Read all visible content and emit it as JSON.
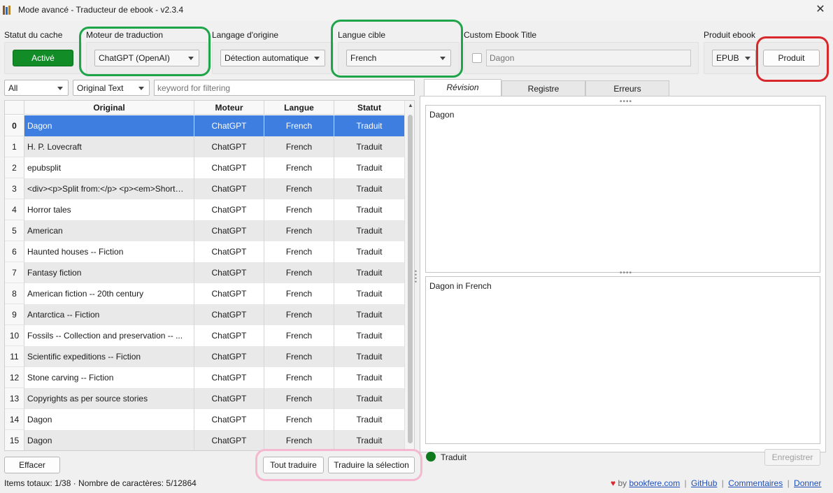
{
  "window": {
    "title": "Mode avancé - Traducteur de ebook - v2.3.4",
    "close_glyph": "✕"
  },
  "cache": {
    "label": "Statut du cache",
    "button": "Activé",
    "color": "#118c26"
  },
  "engine": {
    "label": "Moteur de traduction",
    "value": "ChatGPT (OpenAI)"
  },
  "source_lang": {
    "label": "Langage d'origine",
    "value": "Détection automatique"
  },
  "target_lang": {
    "label": "Langue cible",
    "value": "French"
  },
  "custom_title": {
    "label": "Custom Ebook Title",
    "placeholder": "Dagon"
  },
  "output": {
    "label": "Produit ebook",
    "format": "EPUB",
    "button": "Produit"
  },
  "filter": {
    "scope": "All",
    "mode": "Original Text",
    "placeholder": "keyword for filtering"
  },
  "table": {
    "headers": {
      "original": "Original",
      "engine": "Moteur",
      "language": "Langue",
      "status": "Statut"
    },
    "rows": [
      {
        "idx": "0",
        "original": "Dagon",
        "engine": "ChatGPT",
        "language": "French",
        "status": "Traduit"
      },
      {
        "idx": "1",
        "original": "H. P. Lovecraft",
        "engine": "ChatGPT",
        "language": "French",
        "status": "Traduit"
      },
      {
        "idx": "2",
        "original": "epubsplit",
        "engine": "ChatGPT",
        "language": "French",
        "status": "Traduit"
      },
      {
        "idx": "3",
        "original": "<div><p>Split from:</p> <p><em>Short…",
        "engine": "ChatGPT",
        "language": "French",
        "status": "Traduit"
      },
      {
        "idx": "4",
        "original": "Horror tales",
        "engine": "ChatGPT",
        "language": "French",
        "status": "Traduit"
      },
      {
        "idx": "5",
        "original": "American",
        "engine": "ChatGPT",
        "language": "French",
        "status": "Traduit"
      },
      {
        "idx": "6",
        "original": "Haunted houses -- Fiction",
        "engine": "ChatGPT",
        "language": "French",
        "status": "Traduit"
      },
      {
        "idx": "7",
        "original": "Fantasy fiction",
        "engine": "ChatGPT",
        "language": "French",
        "status": "Traduit"
      },
      {
        "idx": "8",
        "original": "American fiction -- 20th century",
        "engine": "ChatGPT",
        "language": "French",
        "status": "Traduit"
      },
      {
        "idx": "9",
        "original": "Antarctica -- Fiction",
        "engine": "ChatGPT",
        "language": "French",
        "status": "Traduit"
      },
      {
        "idx": "10",
        "original": "Fossils -- Collection and preservation -- ...",
        "engine": "ChatGPT",
        "language": "French",
        "status": "Traduit"
      },
      {
        "idx": "11",
        "original": "Scientific expeditions -- Fiction",
        "engine": "ChatGPT",
        "language": "French",
        "status": "Traduit"
      },
      {
        "idx": "12",
        "original": "Stone carving -- Fiction",
        "engine": "ChatGPT",
        "language": "French",
        "status": "Traduit"
      },
      {
        "idx": "13",
        "original": "Copyrights as per source stories",
        "engine": "ChatGPT",
        "language": "French",
        "status": "Traduit"
      },
      {
        "idx": "14",
        "original": "Dagon",
        "engine": "ChatGPT",
        "language": "French",
        "status": "Traduit"
      },
      {
        "idx": "15",
        "original": "Dagon",
        "engine": "ChatGPT",
        "language": "French",
        "status": "Traduit"
      }
    ]
  },
  "buttons": {
    "clear": "Effacer",
    "translate_all": "Tout traduire",
    "translate_selection": "Traduire la sélection",
    "save": "Enregistrer"
  },
  "tabs": [
    "Révision",
    "Registre",
    "Erreurs"
  ],
  "review": {
    "original_text": "Dagon",
    "translated_text": "Dagon in French",
    "status": "Traduit",
    "status_color": "#0f7a1c"
  },
  "footer": {
    "stats": "Items totaux: 1/38 · Nombre de caractères: 5/12864",
    "heart": "♥",
    "by": "by",
    "site": "bookfere.com",
    "sep": "|",
    "links": [
      "GitHub",
      "Commentaires",
      "Donner"
    ]
  },
  "highlight_colors": {
    "green": "#1ea54a",
    "red": "#d8282b",
    "pink": "#f4b8d0"
  }
}
